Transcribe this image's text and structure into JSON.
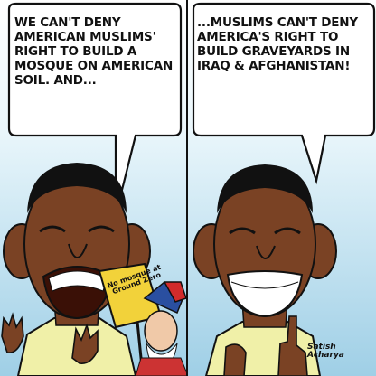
{
  "panels": [
    {
      "caption": "We can't deny American Muslims' right to build a mosque on American soil. And..."
    },
    {
      "caption": "...Muslims can't deny America's right to build graveyards in Iraq & Afghanistan!"
    }
  ],
  "protest_sign": {
    "text": "No mosque at Ground Zero"
  },
  "signature": {
    "line1": "Satish",
    "line2": "Acharya"
  },
  "colors": {
    "sky": "#9fcfe6",
    "sky_light": "#e9f6fb",
    "skin": "#7a4224",
    "shirt": "#f0f0a8",
    "sign": "#f2d23a"
  }
}
